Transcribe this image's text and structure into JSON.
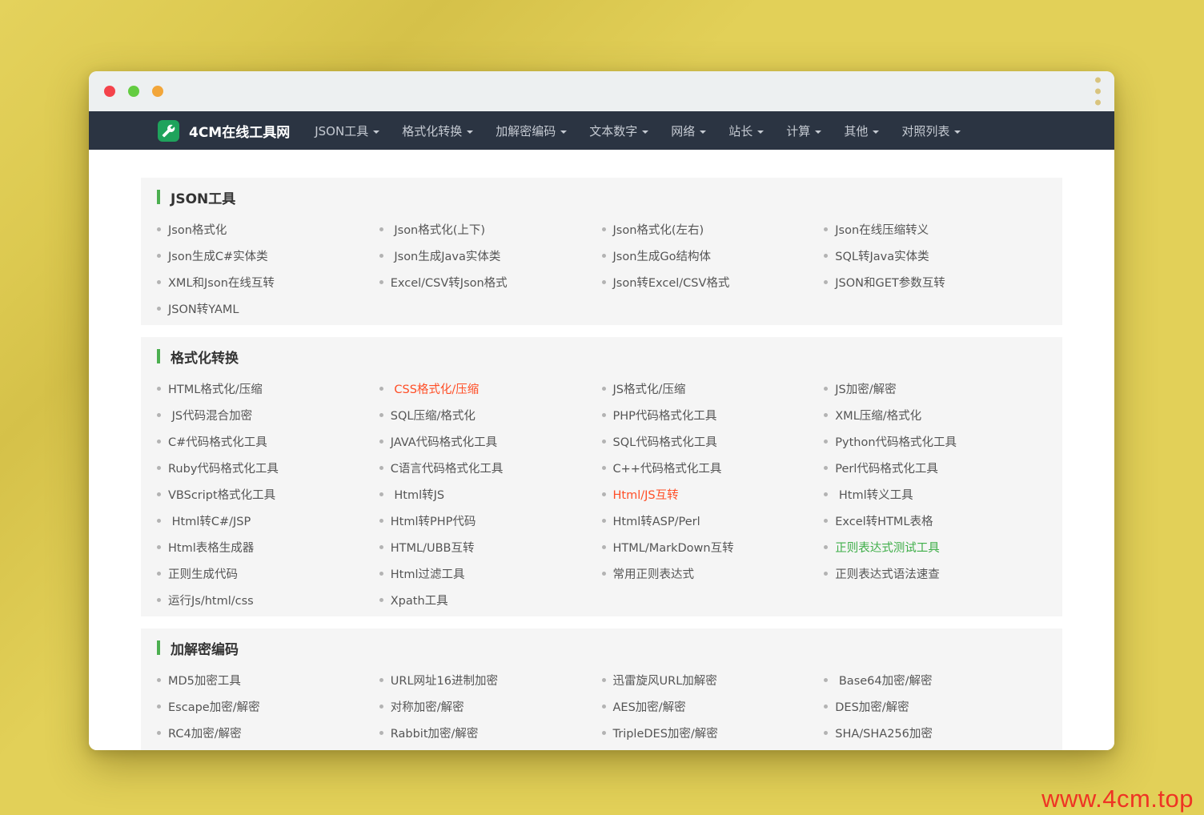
{
  "navbar": {
    "brand": "4CM在线工具网",
    "items": [
      {
        "label": "JSON工具"
      },
      {
        "label": "格式化转换"
      },
      {
        "label": "加解密编码"
      },
      {
        "label": "文本数字"
      },
      {
        "label": "网络"
      },
      {
        "label": "站长"
      },
      {
        "label": "计算"
      },
      {
        "label": "其他"
      },
      {
        "label": "对照列表"
      }
    ]
  },
  "sections": [
    {
      "title": "JSON工具",
      "items": [
        {
          "label": "Json格式化"
        },
        {
          "label": " Json格式化(上下)"
        },
        {
          "label": "Json格式化(左右)"
        },
        {
          "label": "Json在线压缩转义"
        },
        {
          "label": "Json生成C#实体类"
        },
        {
          "label": " Json生成Java实体类"
        },
        {
          "label": "Json生成Go结构体"
        },
        {
          "label": "SQL转Java实体类"
        },
        {
          "label": "XML和Json在线互转"
        },
        {
          "label": "Excel/CSV转Json格式"
        },
        {
          "label": "Json转Excel/CSV格式"
        },
        {
          "label": "JSON和GET参数互转"
        },
        {
          "label": "JSON转YAML"
        },
        {
          "label": ""
        },
        {
          "label": ""
        },
        {
          "label": ""
        }
      ]
    },
    {
      "title": "格式化转换",
      "items": [
        {
          "label": "HTML格式化/压缩"
        },
        {
          "label": " CSS格式化/压缩",
          "color": "orange"
        },
        {
          "label": "JS格式化/压缩"
        },
        {
          "label": "JS加密/解密"
        },
        {
          "label": " JS代码混合加密"
        },
        {
          "label": "SQL压缩/格式化"
        },
        {
          "label": "PHP代码格式化工具"
        },
        {
          "label": "XML压缩/格式化"
        },
        {
          "label": "C#代码格式化工具"
        },
        {
          "label": "JAVA代码格式化工具"
        },
        {
          "label": "SQL代码格式化工具"
        },
        {
          "label": "Python代码格式化工具"
        },
        {
          "label": "Ruby代码格式化工具"
        },
        {
          "label": "C语言代码格式化工具"
        },
        {
          "label": "C++代码格式化工具"
        },
        {
          "label": "Perl代码格式化工具"
        },
        {
          "label": "VBScript格式化工具"
        },
        {
          "label": " Html转JS"
        },
        {
          "label": "Html/JS互转",
          "color": "orange"
        },
        {
          "label": " Html转义工具"
        },
        {
          "label": " Html转C#/JSP"
        },
        {
          "label": "Html转PHP代码"
        },
        {
          "label": "Html转ASP/Perl"
        },
        {
          "label": "Excel转HTML表格"
        },
        {
          "label": "Html表格生成器"
        },
        {
          "label": "HTML/UBB互转"
        },
        {
          "label": "HTML/MarkDown互转"
        },
        {
          "label": "正则表达式测试工具",
          "color": "green"
        },
        {
          "label": "正则生成代码"
        },
        {
          "label": "Html过滤工具"
        },
        {
          "label": "常用正则表达式"
        },
        {
          "label": "正则表达式语法速查"
        },
        {
          "label": "运行Js/html/css"
        },
        {
          "label": "Xpath工具"
        },
        {
          "label": ""
        },
        {
          "label": ""
        }
      ]
    },
    {
      "title": "加解密编码",
      "items": [
        {
          "label": "MD5加密工具"
        },
        {
          "label": "URL网址16进制加密"
        },
        {
          "label": "迅雷旋风URL加解密"
        },
        {
          "label": " Base64加密/解密"
        },
        {
          "label": "Escape加密/解密"
        },
        {
          "label": "对称加密/解密"
        },
        {
          "label": "AES加密/解密"
        },
        {
          "label": "DES加密/解密"
        },
        {
          "label": "RC4加密/解密"
        },
        {
          "label": "Rabbit加密/解密"
        },
        {
          "label": "TripleDES加密/解密"
        },
        {
          "label": "SHA/SHA256加密"
        },
        {
          "label": ""
        },
        {
          "label": ""
        },
        {
          "label": ""
        },
        {
          "label": ""
        }
      ]
    }
  ],
  "watermark": "www.4cm.top",
  "colors": {
    "background": "#e2d058",
    "navbar_bg": "#2b3442",
    "logo_green": "#1fa35c",
    "accent_green": "#4caf50",
    "link_default": "#555555",
    "link_orange": "#ff4e26",
    "link_green": "#3fae49",
    "watermark_red": "#ee3424",
    "traffic_red": "#f4434b",
    "traffic_green": "#63cc41",
    "traffic_orange": "#f2a63a"
  }
}
